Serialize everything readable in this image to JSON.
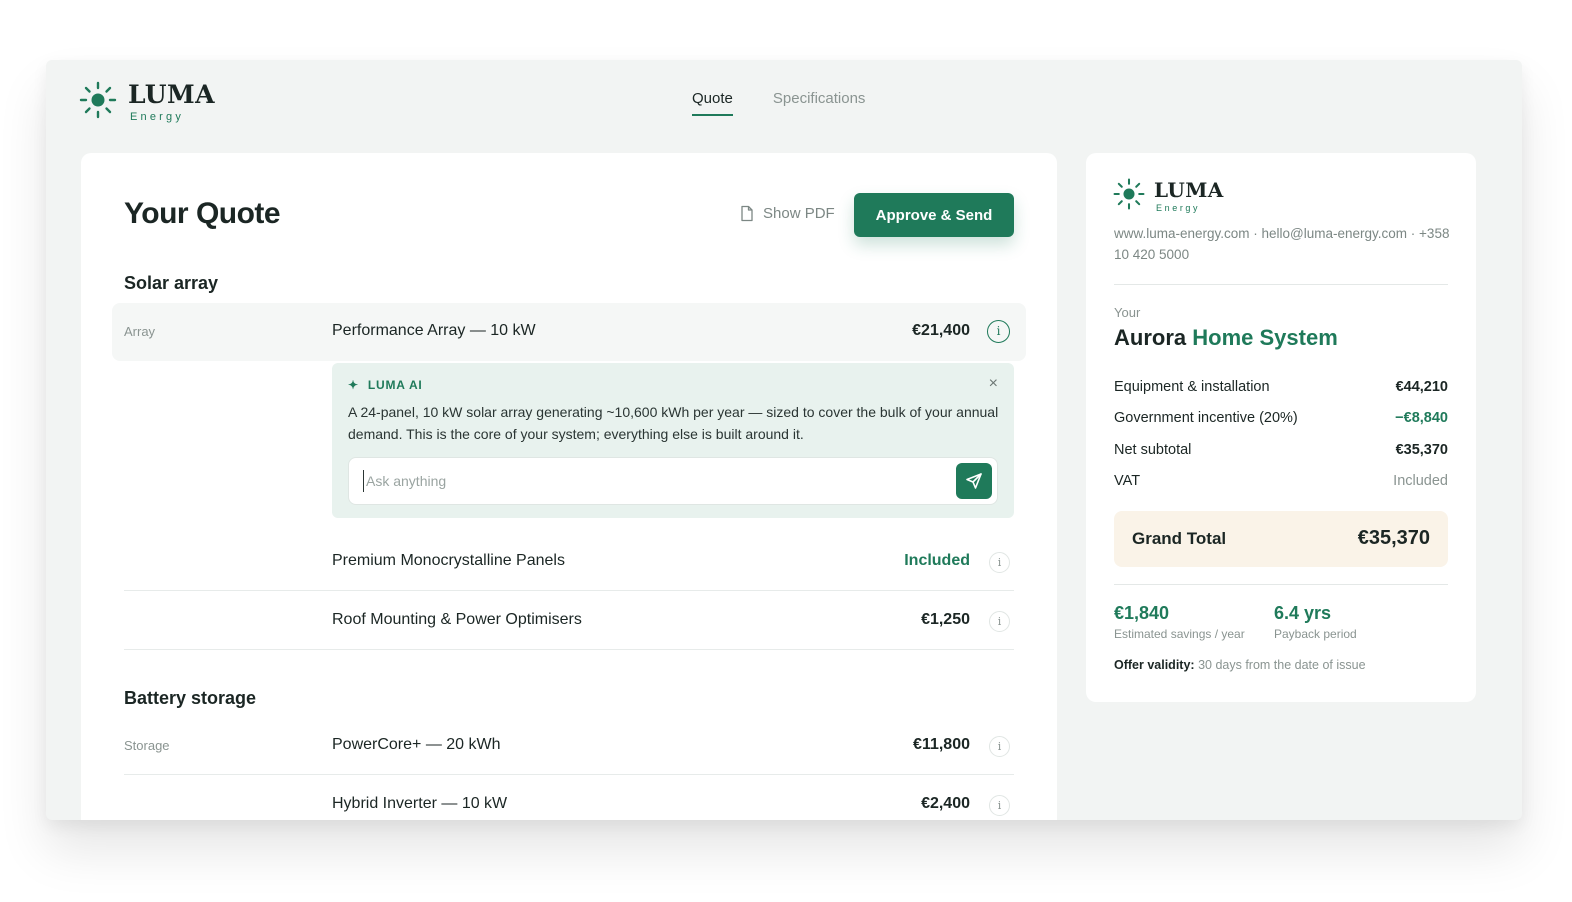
{
  "brand": {
    "name": "LUMA",
    "tagline": "Energy"
  },
  "nav": {
    "tabs": [
      {
        "label": "Quote",
        "active": true
      },
      {
        "label": "Specifications",
        "active": false
      }
    ]
  },
  "quote": {
    "title": "Your Quote",
    "show_pdf_label": "Show PDF",
    "approve_label": "Approve & Send",
    "sections": [
      {
        "title": "Solar array",
        "items": [
          {
            "category": "Array",
            "name": "Performance Array — 10 kW",
            "price": "€21,400"
          },
          {
            "category": "",
            "name": "Premium Monocrystalline Panels",
            "price": "Included"
          },
          {
            "category": "",
            "name": "Roof Mounting & Power Optimisers",
            "price": "€1,250"
          }
        ]
      },
      {
        "title": "Battery storage",
        "items": [
          {
            "category": "Storage",
            "name": "PowerCore+ — 20 kWh",
            "price": "€11,800"
          },
          {
            "category": "",
            "name": "Hybrid Inverter — 10 kW",
            "price": "€2,400"
          }
        ]
      }
    ],
    "info_glyph": "i"
  },
  "ai": {
    "header": "LUMA AI",
    "spark_glyph": "✦",
    "close_glyph": "×",
    "message": "A 24-panel, 10 kW solar array generating ~10,600 kWh per year — sized to cover the bulk of your annual demand. This is the core of your system; everything else is built around it.",
    "input_placeholder": "Ask anything",
    "input_value": ""
  },
  "summary": {
    "brand": {
      "name": "LUMA",
      "tagline": "Energy"
    },
    "contact": "www.luma-energy.com  ·  hello@luma-energy.com  ·  +358 10 420 5000",
    "your_label": "Your",
    "product_name": "Aurora",
    "product_accent": "Home System",
    "lines": [
      {
        "label": "Equipment & installation",
        "value": "€44,210"
      },
      {
        "label": "Government incentive (20%)",
        "value": "−€8,840"
      },
      {
        "label": "Net subtotal",
        "value": "€35,370"
      },
      {
        "label": "VAT",
        "value": "Included"
      }
    ],
    "grand_total": {
      "label": "Grand Total",
      "value": "€35,370"
    },
    "savings": {
      "value": "€1,840",
      "label": "Estimated savings / year"
    },
    "payback": {
      "value": "6.4 yrs",
      "label": "Payback period"
    },
    "validity": {
      "label": "Offer validity:",
      "text": "30 days from the date of issue"
    }
  },
  "colors": {
    "accent": "#1f7a5a",
    "background": "#f2f4f3",
    "card": "#ffffff",
    "total_bg": "#faf3e8"
  }
}
